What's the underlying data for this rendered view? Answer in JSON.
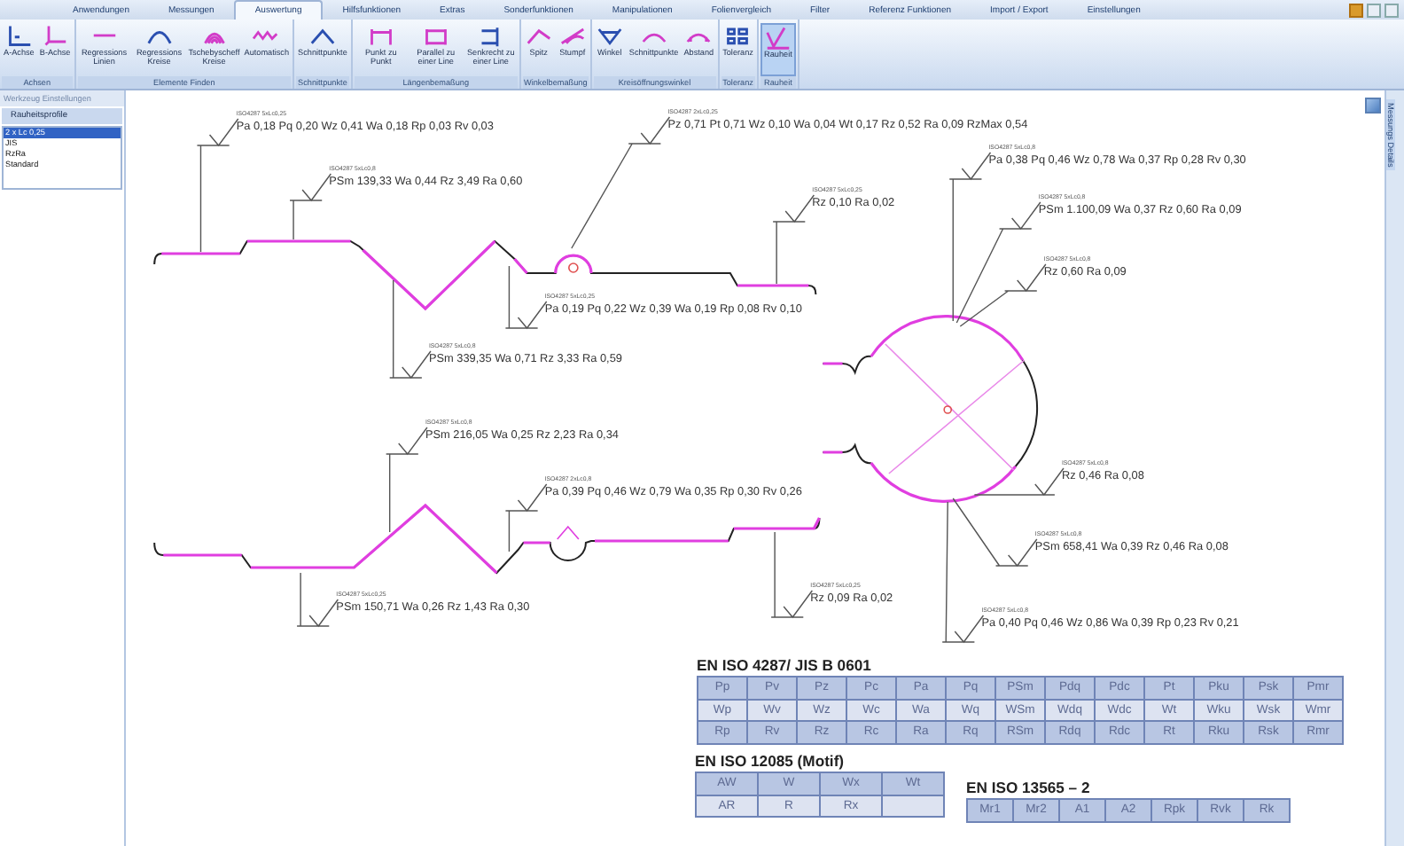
{
  "ribbon": {
    "tabs": [
      {
        "label": "Anwendungen",
        "selected": false
      },
      {
        "label": "Messungen",
        "selected": false
      },
      {
        "label": "Auswertung",
        "selected": true
      },
      {
        "label": "Hilfsfunktionen",
        "selected": false
      },
      {
        "label": "Extras",
        "selected": false
      },
      {
        "label": "Sonderfunktionen",
        "selected": false
      },
      {
        "label": "Manipulationen",
        "selected": false
      },
      {
        "label": "Folienvergleich",
        "selected": false
      },
      {
        "label": "Filter",
        "selected": false
      },
      {
        "label": "Referenz Funktionen",
        "selected": false
      },
      {
        "label": "Import / Export",
        "selected": false
      },
      {
        "label": "Einstellungen",
        "selected": false
      }
    ],
    "groups": [
      {
        "label": "Achsen",
        "buttons": [
          {
            "label": "A-Achse",
            "selected": false
          },
          {
            "label": "B-Achse",
            "selected": false
          }
        ]
      },
      {
        "label": "Elemente Finden",
        "buttons": [
          {
            "label": "Regressions Linien",
            "selected": false
          },
          {
            "label": "Regressions Kreise",
            "selected": false
          },
          {
            "label": "Tschebyscheff Kreise",
            "selected": false
          },
          {
            "label": "Automatisch",
            "selected": false
          }
        ]
      },
      {
        "label": "Schnittpunkte",
        "buttons": [
          {
            "label": "Schnittpunkte",
            "selected": false
          }
        ]
      },
      {
        "label": "Längenbemaßung",
        "buttons": [
          {
            "label": "Punkt zu Punkt",
            "selected": false
          },
          {
            "label": "Parallel zu einer Line",
            "selected": false
          },
          {
            "label": "Senkrecht zu einer Line",
            "selected": false
          }
        ]
      },
      {
        "label": "Winkelbemaßung",
        "buttons": [
          {
            "label": "Spitz",
            "selected": false
          },
          {
            "label": "Stumpf",
            "selected": false
          }
        ]
      },
      {
        "label": "Kreisöffnungswinkel",
        "buttons": [
          {
            "label": "Winkel",
            "selected": false
          },
          {
            "label": "Schnittpunkte",
            "selected": false
          },
          {
            "label": "Abstand",
            "selected": false
          }
        ]
      },
      {
        "label": "Toleranz",
        "buttons": [
          {
            "label": "Toleranz",
            "selected": false
          }
        ]
      },
      {
        "label": "Rauheit",
        "buttons": [
          {
            "label": "Rauheit",
            "selected": true
          }
        ]
      }
    ]
  },
  "side_panel": {
    "title": "Werkzeug Einstellungen",
    "section": "Rauheitsprofile",
    "items": [
      {
        "label": "2 x Lc 0,25",
        "selected": true
      },
      {
        "label": "JIS",
        "selected": false
      },
      {
        "label": "RzRa",
        "selected": false
      },
      {
        "label": "Standard",
        "selected": false
      }
    ]
  },
  "right_tab": {
    "label": "Messungs Details"
  },
  "canvas": {
    "annotations": [
      {
        "filter": "ISO4287 5xLc0,25",
        "values": "Pa 0,18 Pq 0,20 Wz 0,41 Wa 0,18 Rp 0,03 Rv 0,03"
      },
      {
        "filter": "ISO4287 5xLc0,8",
        "values": "PSm 139,33 Wa 0,44 Rz 3,49 Ra 0,60"
      },
      {
        "filter": "ISO4287 2xLc0,25",
        "values": "Pz 0,71 Pt 0,71 Wz 0,10 Wa 0,04 Wt 0,17 Rz 0,52 Ra 0,09 RzMax 0,54"
      },
      {
        "filter": "ISO4287 5xLc0,25",
        "values": "Rz 0,10 Ra 0,02"
      },
      {
        "filter": "ISO4287 5xLc0,25",
        "values": "Pa 0,19 Pq 0,22 Wz 0,39 Wa 0,19 Rp 0,08 Rv 0,10"
      },
      {
        "filter": "ISO4287 5xLc0,8",
        "values": "PSm 339,35 Wa 0,71 Rz 3,33 Ra 0,59"
      },
      {
        "filter": "ISO4287 5xLc0,8",
        "values": "Pa 0,38 Pq 0,46 Wz 0,78 Wa 0,37 Rp 0,28 Rv 0,30"
      },
      {
        "filter": "ISO4287 5xLc0,8",
        "values": "PSm 1.100,09 Wa 0,37 Rz 0,60 Ra 0,09"
      },
      {
        "filter": "ISO4287 5xLc0,8",
        "values": "Rz 0,60 Ra 0,09"
      },
      {
        "filter": "ISO4287 5xLc0,8",
        "values": "Rz 0,46 Ra 0,08"
      },
      {
        "filter": "ISO4287 5xLc0,8",
        "values": "PSm 658,41 Wa 0,39 Rz 0,46 Ra 0,08"
      },
      {
        "filter": "ISO4287 5xLc0,8",
        "values": "Pa 0,40 Pq 0,46 Wz 0,86 Wa 0,39 Rp 0,23 Rv 0,21"
      },
      {
        "filter": "ISO4287 5xLc0,8",
        "values": "PSm 216,05 Wa 0,25 Rz 2,23 Ra 0,34"
      },
      {
        "filter": "ISO4287 2xLc0,8",
        "values": "Pa 0,39 Pq 0,46 Wz 0,79 Wa 0,35 Rp 0,30 Rv 0,26"
      },
      {
        "filter": "ISO4287 5xLc0,25",
        "values": "PSm 150,71 Wa 0,26 Rz 1,43 Ra 0,30"
      },
      {
        "filter": "ISO4287 5xLc0,25",
        "values": "Rz 0,09 Ra 0,02"
      }
    ],
    "tables": [
      {
        "title": "EN ISO 4287/ JIS B 0601",
        "rows": [
          [
            "Pp",
            "Pv",
            "Pz",
            "Pc",
            "Pa",
            "Pq",
            "PSm",
            "Pdq",
            "Pdc",
            "Pt",
            "Pku",
            "Psk",
            "Pmr"
          ],
          [
            "Wp",
            "Wv",
            "Wz",
            "Wc",
            "Wa",
            "Wq",
            "WSm",
            "Wdq",
            "Wdc",
            "Wt",
            "Wku",
            "Wsk",
            "Wmr"
          ],
          [
            "Rp",
            "Rv",
            "Rz",
            "Rc",
            "Ra",
            "Rq",
            "RSm",
            "Rdq",
            "Rdc",
            "Rt",
            "Rku",
            "Rsk",
            "Rmr"
          ]
        ]
      },
      {
        "title": "EN ISO 12085 (Motif)",
        "rows": [
          [
            "AW",
            "W",
            "Wx",
            "Wt"
          ],
          [
            "AR",
            "R",
            "Rx"
          ]
        ]
      },
      {
        "title": "EN ISO 13565 – 2",
        "rows": [
          [
            "Mr1",
            "Mr2",
            "A1",
            "A2",
            "Rpk",
            "Rvk",
            "Rk"
          ]
        ]
      }
    ]
  }
}
